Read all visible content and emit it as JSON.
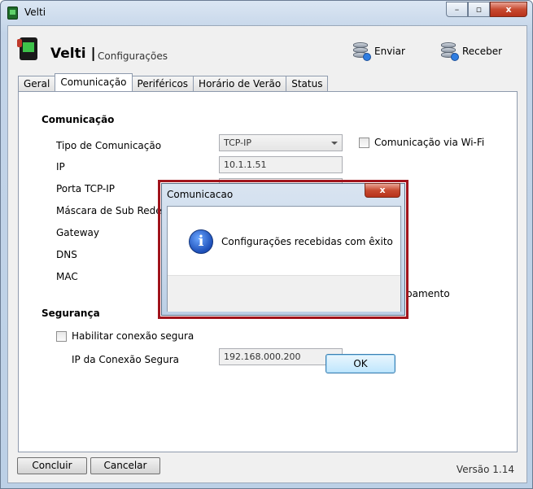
{
  "window": {
    "title": "Velti"
  },
  "header": {
    "brand": "Velti |",
    "subtitle": "Configurações",
    "send_label": "Enviar",
    "receive_label": "Receber"
  },
  "tabs": [
    {
      "label": "Geral"
    },
    {
      "label": "Comunicação"
    },
    {
      "label": "Periféricos"
    },
    {
      "label": "Horário de Verão"
    },
    {
      "label": "Status"
    }
  ],
  "comunicacao": {
    "section_title": "Comunicação",
    "tipo_label": "Tipo de Comunicação",
    "tipo_value": "TCP-IP",
    "wifi_label": "Comunicação via Wi-Fi",
    "ip_label": "IP",
    "ip_value": "10.1.1.51",
    "porta_label": "Porta TCP-IP",
    "mascara_label": "Máscara de Sub Rede",
    "gateway_label": "Gateway",
    "dns_label": "DNS",
    "mac_label": "MAC",
    "partial_text": "pamento"
  },
  "seguranca": {
    "section_title": "Segurança",
    "enable_label": "Habilitar conexão segura",
    "ip_label": "IP da Conexão Segura",
    "ip_value": "192.168.000.200"
  },
  "footer": {
    "conclude_label": "Concluir",
    "cancel_label": "Cancelar",
    "version": "Versão 1.14"
  },
  "dialog": {
    "title": "Comunicacao",
    "close_glyph": "x",
    "icon_glyph": "i",
    "message": "Configurações recebidas com êxito",
    "ok_label": "OK"
  },
  "window_controls": {
    "minimize": "–",
    "maximize": "▫",
    "close": "x"
  }
}
